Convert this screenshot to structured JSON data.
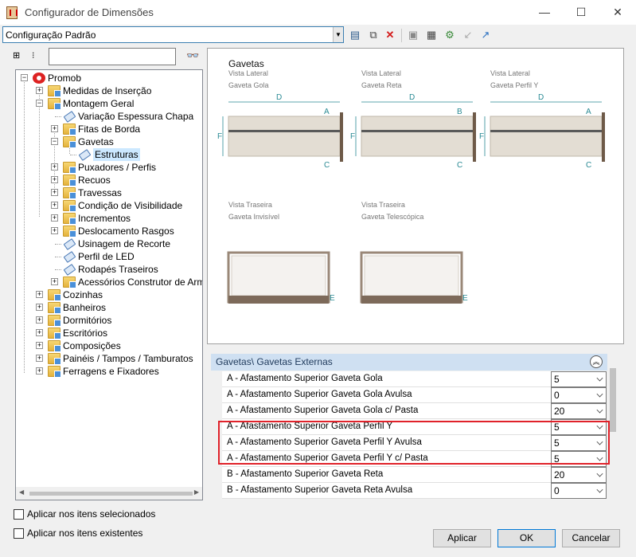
{
  "window": {
    "title": "Configurador de Dimensões",
    "minimize": "—",
    "maximize": "☐",
    "close": "✕"
  },
  "toolbar": {
    "config_value": "Configuração Padrão"
  },
  "tree": [
    {
      "label": "Promob",
      "level": 0,
      "exp": "−",
      "icon": "promob"
    },
    {
      "label": "Medidas de Inserção",
      "level": 1,
      "exp": "+",
      "icon": "folder"
    },
    {
      "label": "Montagem Geral",
      "level": 1,
      "exp": "−",
      "icon": "folder"
    },
    {
      "label": "Variação Espessura Chapa",
      "level": 2,
      "exp": "",
      "icon": "tag"
    },
    {
      "label": "Fitas de Borda",
      "level": 2,
      "exp": "+",
      "icon": "folder"
    },
    {
      "label": "Gavetas",
      "level": 2,
      "exp": "−",
      "icon": "folder"
    },
    {
      "label": "Estruturas",
      "level": 3,
      "exp": "",
      "icon": "tag",
      "selected": true
    },
    {
      "label": "Puxadores / Perfis",
      "level": 2,
      "exp": "+",
      "icon": "folder"
    },
    {
      "label": "Recuos",
      "level": 2,
      "exp": "+",
      "icon": "folder"
    },
    {
      "label": "Travessas",
      "level": 2,
      "exp": "+",
      "icon": "folder"
    },
    {
      "label": "Condição de Visibilidade",
      "level": 2,
      "exp": "+",
      "icon": "folder"
    },
    {
      "label": "Incrementos",
      "level": 2,
      "exp": "+",
      "icon": "folder"
    },
    {
      "label": "Deslocamento Rasgos",
      "level": 2,
      "exp": "+",
      "icon": "folder"
    },
    {
      "label": "Usinagem de Recorte",
      "level": 2,
      "exp": "",
      "icon": "tag"
    },
    {
      "label": "Perfil de LED",
      "level": 2,
      "exp": "",
      "icon": "tag"
    },
    {
      "label": "Rodapés Traseiros",
      "level": 2,
      "exp": "",
      "icon": "tag"
    },
    {
      "label": "Acessórios Construtor de Armário",
      "level": 2,
      "exp": "+",
      "icon": "folder"
    },
    {
      "label": "Cozinhas",
      "level": 1,
      "exp": "+",
      "icon": "folder"
    },
    {
      "label": "Banheiros",
      "level": 1,
      "exp": "+",
      "icon": "folder"
    },
    {
      "label": "Dormitórios",
      "level": 1,
      "exp": "+",
      "icon": "folder"
    },
    {
      "label": "Escritórios",
      "level": 1,
      "exp": "+",
      "icon": "folder"
    },
    {
      "label": "Composições",
      "level": 1,
      "exp": "+",
      "icon": "folder"
    },
    {
      "label": "Painéis / Tampos / Tamburatos",
      "level": 1,
      "exp": "+",
      "icon": "folder"
    },
    {
      "label": "Ferragens e Fixadores",
      "level": 1,
      "exp": "+",
      "icon": "folder"
    }
  ],
  "preview": {
    "title": "Gavetas",
    "items": [
      {
        "view": "Vista Lateral",
        "name": "Gaveta Gola",
        "labels": [
          "D",
          "A",
          "F",
          "C"
        ]
      },
      {
        "view": "Vista Lateral",
        "name": "Gaveta Reta",
        "labels": [
          "D",
          "B",
          "F",
          "C"
        ]
      },
      {
        "view": "Vista Lateral",
        "name": "Gaveta Perfil Y",
        "labels": [
          "D",
          "A",
          "F",
          "C"
        ]
      },
      {
        "view": "Vista Traseira",
        "name": "Gaveta Invisível",
        "labels": [
          "E"
        ]
      },
      {
        "view": "Vista Traseira",
        "name": "Gaveta Telescópica",
        "labels": [
          "E"
        ]
      }
    ]
  },
  "properties": {
    "header": "Gavetas\\ Gavetas Externas",
    "rows": [
      {
        "label": "A - Afastamento Superior Gaveta Gola",
        "value": "5"
      },
      {
        "label": "A - Afastamento Superior Gaveta Gola Avulsa",
        "value": "0"
      },
      {
        "label": "A - Afastamento Superior Gaveta Gola c/ Pasta",
        "value": "20"
      },
      {
        "label": "A - Afastamento Superior Gaveta Perfil Y",
        "value": "5"
      },
      {
        "label": "A - Afastamento Superior Gaveta Perfil Y Avulsa",
        "value": "5"
      },
      {
        "label": "A - Afastamento Superior Gaveta Perfil Y c/ Pasta",
        "value": "5"
      },
      {
        "label": "B - Afastamento Superior Gaveta Reta",
        "value": "20"
      },
      {
        "label": "B - Afastamento Superior Gaveta Reta Avulsa",
        "value": "0"
      }
    ]
  },
  "footer": {
    "apply_selected": "Aplicar nos itens selecionados",
    "apply_existing": "Aplicar nos itens existentes",
    "apply_button": "Aplicar",
    "ok_button": "OK",
    "cancel_button": "Cancelar"
  },
  "colors": {
    "accent": "#3c7fb1",
    "highlight_border": "#e0222a",
    "selection": "#cce8ff",
    "prop_header": "#cfe0f2"
  }
}
